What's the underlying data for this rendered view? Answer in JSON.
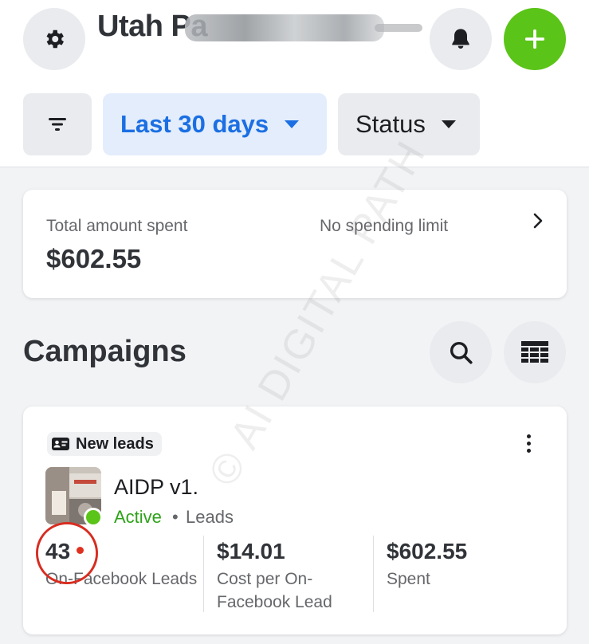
{
  "header": {
    "account_name": "Utah Pa",
    "settings_icon": "gear-icon",
    "notifications_icon": "bell-icon",
    "create_icon": "plus-icon",
    "create_color": "#5bc418"
  },
  "filters": {
    "filter_icon": "filter-lines-icon",
    "date_range": "Last 30 days",
    "status": "Status"
  },
  "spend_summary": {
    "label": "Total amount spent",
    "value": "$602.55",
    "limit_text": "No spending limit"
  },
  "campaigns_section": {
    "title": "Campaigns",
    "search_icon": "search-icon",
    "table_icon": "table-icon"
  },
  "campaign": {
    "badge": "New leads",
    "name": "AIDP v1.",
    "status": "Active",
    "separator": "•",
    "type": "Leads",
    "status_color": "#2ea219",
    "metrics": [
      {
        "value": "43",
        "label": "On-Facebook Leads"
      },
      {
        "value": "$14.01",
        "label": "Cost per On-Facebook Lead"
      },
      {
        "value": "$602.55",
        "label": "Spent"
      }
    ]
  },
  "watermark": "© AI DIGITAL PATH"
}
